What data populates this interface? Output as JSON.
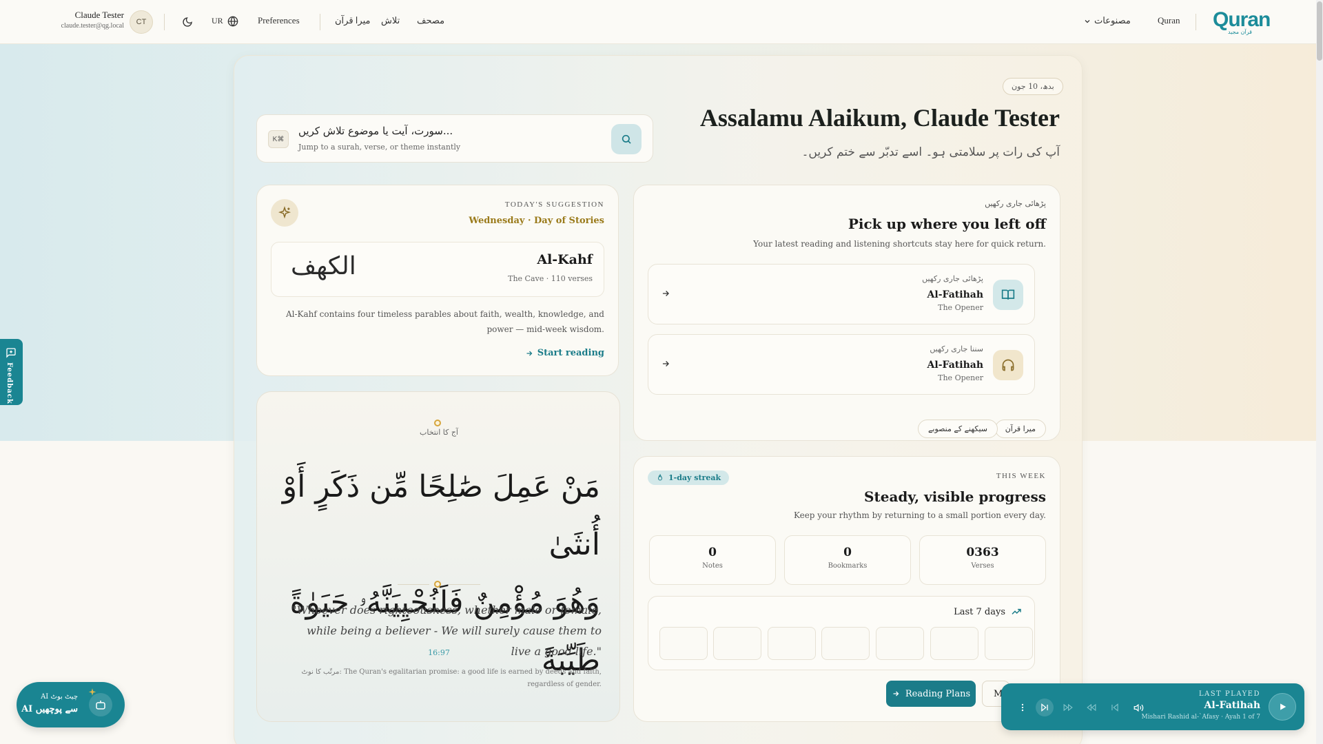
{
  "header": {
    "user_name": "Claude Tester",
    "user_email": "claude.tester@qg.local",
    "avatar_initials": "CT",
    "lang": "UR",
    "preferences": "Preferences",
    "nav": [
      "میرا قرآن",
      "تلاش",
      "مصحف"
    ],
    "products": "مصنوعات",
    "quran_link": "Quran",
    "logo": "Quran",
    "logo_sub": "قرآن مجيد"
  },
  "hero": {
    "date": "بدھ، 10 جون",
    "greeting": "Assalamu Alaikum, Claude Tester",
    "subtitle": "آپ کی رات پر سلامتی ہو۔ اسے تدبّر سے ختم کریں۔"
  },
  "search": {
    "kbd": "K⌘",
    "title": "سورت، آیت یا موضوع تلاش کریں...",
    "subtitle": "Jump to a surah, verse, or theme instantly"
  },
  "suggestion": {
    "label": "TODAY'S SUGGESTION",
    "day": "Wednesday · Day of Stories",
    "surah_ar": "الكهف",
    "surah_en": "Al-Kahf",
    "surah_meta": "The Cave · 110 verses",
    "desc": "Al-Kahf contains four timeless parables about faith, wealth, knowledge, and power — mid-week wisdom.",
    "cta": "Start reading"
  },
  "ayah": {
    "label": "آج کا انتخاب",
    "arabic_line1": "مَنْ عَمِلَ صَٰلِحًا مِّن ذَكَرٍ أَوْ أُنثَىٰ",
    "arabic_line2": "وَهُوَ مُؤْمِنٌ فَلَنُحْيِيَنَّهُۥ حَيَوٰةً طَيِّبَةً",
    "translation": "\"Whoever does righteousness, whether male or female, while being a believer - We will surely cause them to live a good life.\"",
    "ref": "16:97",
    "note": "مرتّب کا نوٹ: The Quran's egalitarian promise: a good life is earned by deeds and faith, regardless of gender."
  },
  "continue": {
    "kicker": "پڑھائی جاری رکھیں",
    "title": "Pick up where you left off",
    "subtitle": "Your latest reading and listening shortcuts stay here for quick return.",
    "items": [
      {
        "kicker": "پڑھائی جاری رکھیں",
        "name": "Al-Fatihah",
        "sub": "The Opener",
        "icon": "book-open-icon"
      },
      {
        "kicker": "سننا جاری رکھیں",
        "name": "Al-Fatihah",
        "sub": "The Opener",
        "icon": "headphones-icon"
      }
    ],
    "chips": [
      "میرا قرآن",
      "سیکھنے کے منصوبے"
    ]
  },
  "progress": {
    "streak": "1-day streak",
    "kicker": "THIS WEEK",
    "title": "Steady, visible progress",
    "subtitle": "Keep your rhythm by returning to a small portion every day.",
    "stats": [
      {
        "value": "0363",
        "label": "Verses"
      },
      {
        "value": "0",
        "label": "Bookmarks"
      },
      {
        "value": "0",
        "label": "Notes"
      }
    ],
    "week_title": "Last 7 days",
    "primary_btn": "Reading Plans",
    "secondary_btn": "M"
  },
  "player": {
    "kicker": "LAST PLAYED",
    "name": "Al-Fatihah",
    "meta": "Mishari Rashid al-`Afasy · Ayah 1 of 7"
  },
  "feedback": "Feedback",
  "ai": {
    "line1": "AI چیٹ بوٹ",
    "line2": "AI سے پوچھیں"
  },
  "colors": {
    "accent": "#1a8592",
    "gold": "#9a7a1a"
  }
}
